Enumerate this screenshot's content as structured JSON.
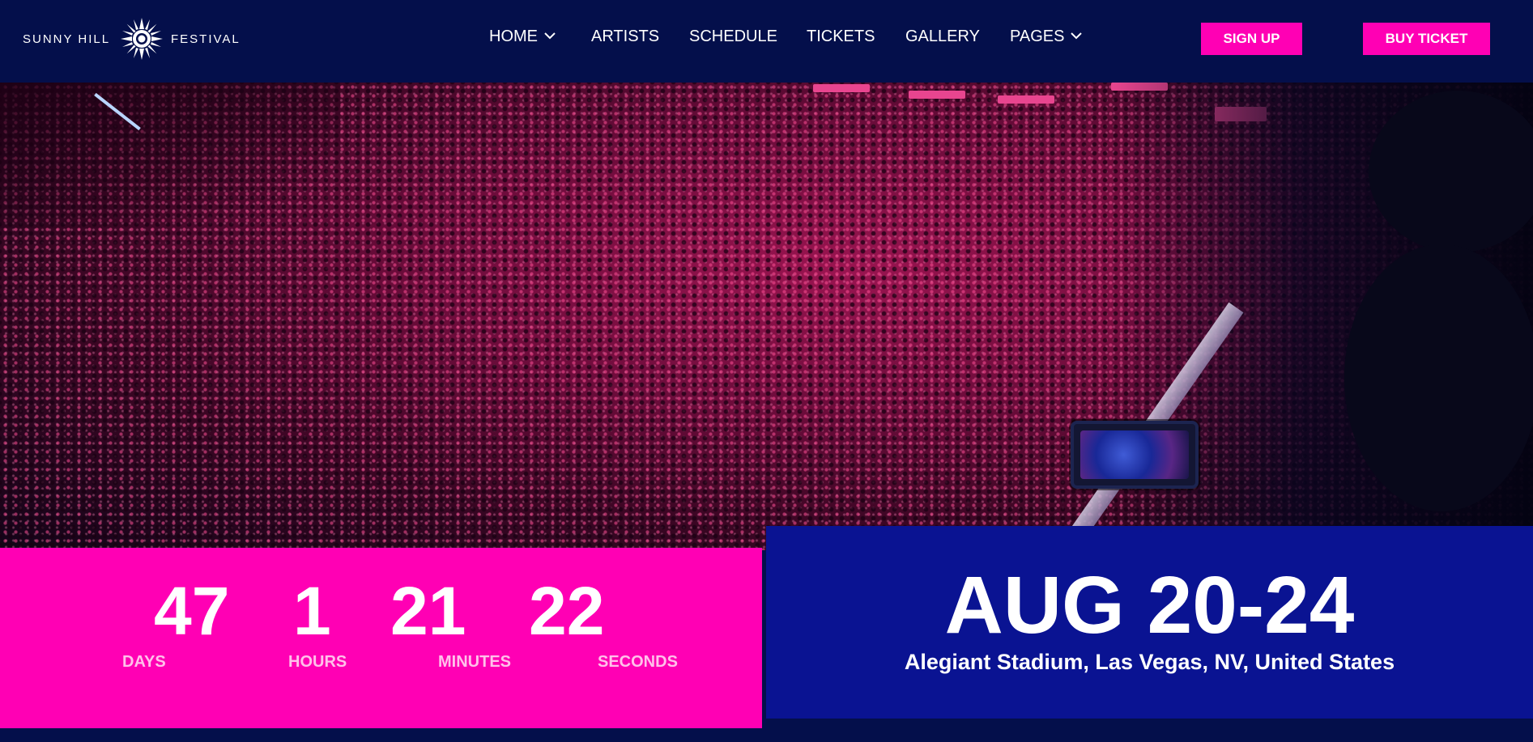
{
  "header": {
    "logo_left": "SUNNY HILL",
    "logo_right": "FESTIVAL",
    "nav": [
      {
        "label": "HOME",
        "dropdown": true
      },
      {
        "label": "ARTISTS",
        "dropdown": false
      },
      {
        "label": "SCHEDULE",
        "dropdown": false
      },
      {
        "label": "TICKETS",
        "dropdown": false
      },
      {
        "label": "GALLERY",
        "dropdown": false
      },
      {
        "label": "PAGES",
        "dropdown": true
      }
    ],
    "sign_up_label": "SIGN UP",
    "buy_ticket_label": "BUY TICKET"
  },
  "countdown": {
    "days": {
      "value": "47",
      "label": "DAYS"
    },
    "hours": {
      "value": "1",
      "label": "HOURS"
    },
    "minutes": {
      "value": "21",
      "label": "MINUTES"
    },
    "seconds": {
      "value": "22",
      "label": "SECONDS"
    }
  },
  "event": {
    "dates": "AUG 20-24",
    "location": "Alegiant Stadium, Las Vegas, NV, United States"
  },
  "colors": {
    "background": "#040f4b",
    "accent_pink": "#ff00b4",
    "date_panel": "#0a1392"
  },
  "icons": {
    "logo": "sun-burst-icon",
    "dropdown": "chevron-down-icon"
  }
}
